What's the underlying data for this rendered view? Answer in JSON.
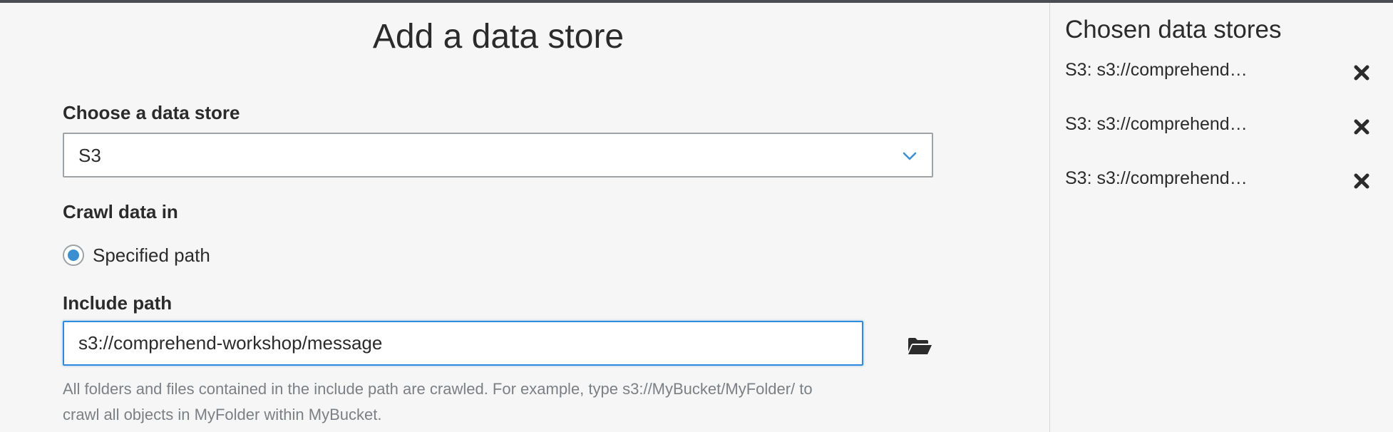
{
  "form": {
    "title": "Add a data store",
    "choose_label": "Choose a data store",
    "selected_store": "S3",
    "crawl_label": "Crawl data in",
    "radio_label": "Specified path",
    "include_label": "Include path",
    "include_value": "s3://comprehend-workshop/message",
    "help_line1": "All folders and files contained in the include path are crawled. For example, type s3://MyBucket/MyFolder/ to",
    "help_line2": "crawl all objects in MyFolder within MyBucket."
  },
  "sidebar": {
    "title": "Chosen data stores",
    "items": [
      {
        "label": "S3: s3://comprehend…"
      },
      {
        "label": "S3: s3://comprehend…"
      },
      {
        "label": "S3: s3://comprehend…"
      }
    ]
  },
  "icons": {
    "dropdown": "chevron-down-icon",
    "browse": "folder-open-icon",
    "remove": "close-icon"
  },
  "colors": {
    "accent": "#2e8be0",
    "radio": "#3b8fd0",
    "help_text": "#7c8085"
  }
}
